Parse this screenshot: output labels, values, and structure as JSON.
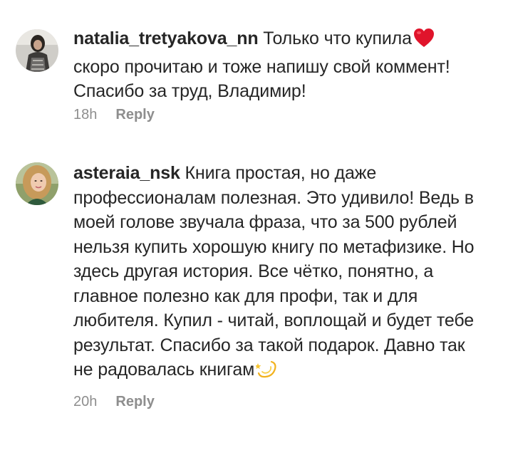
{
  "comments": [
    {
      "username": "natalia_tretyakova_nn",
      "text": "Только что купила",
      "text_after": "скоро прочитаю и тоже напишу свой коммент! Спасибо за труд, Владимир!",
      "emoji": "heart-emoji",
      "time": "18h",
      "reply_label": "Reply"
    },
    {
      "username": "asteraia_nsk",
      "text": "Книга простая, но даже профессионалам полезная. Это удивило! Ведь в моей голове звучала фраза, что за 500 рублей нельзя купить хорошую книгу по метафизике. Но здесь другая история. Все чётко, понятно, а главное полезно как для профи, так и для любителя. Купил - читай, воплощай и будет тебе результат. Спасибо за такой подарок. Давно так не радовалась книгам",
      "emoji": "dizzy-emoji",
      "time": "20h",
      "reply_label": "Reply"
    }
  ]
}
